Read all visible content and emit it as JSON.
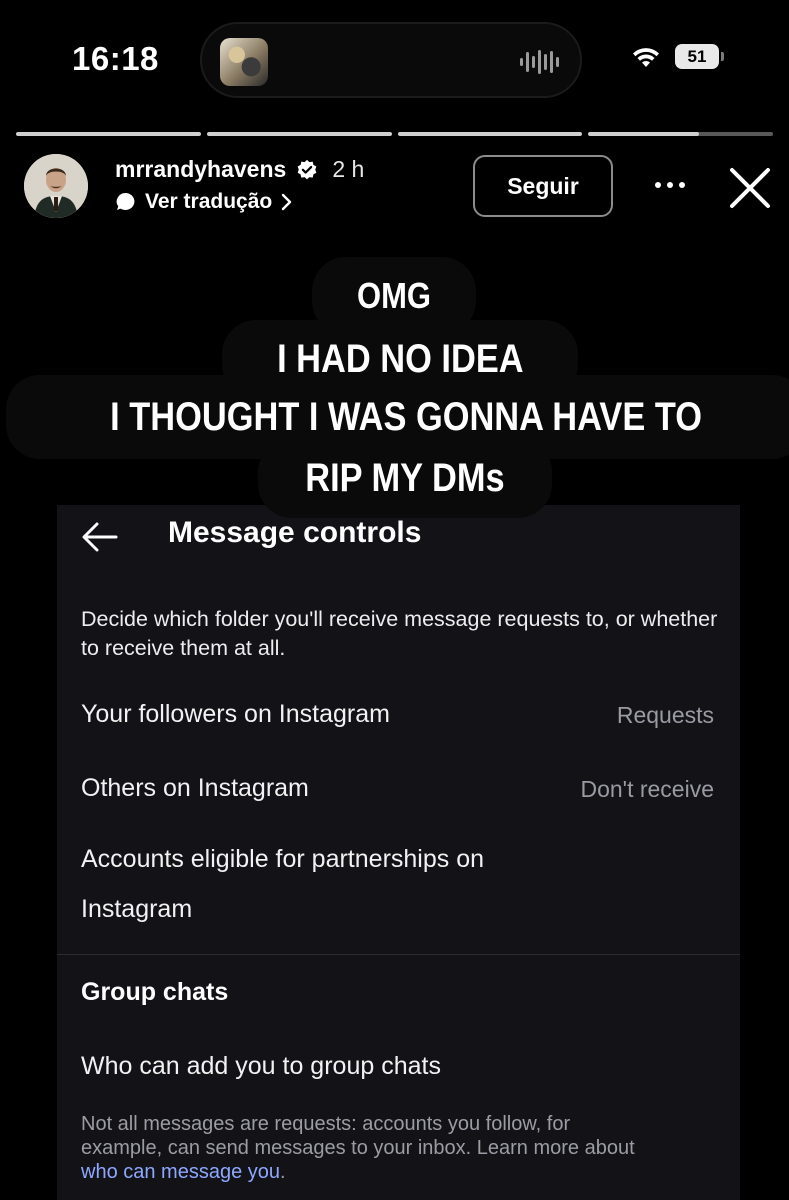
{
  "status_bar": {
    "time": "16:18",
    "battery": "51"
  },
  "story": {
    "username": "mrrandyhavens",
    "time_ago": "2 h",
    "translate_label": "Ver tradução",
    "follow_label": "Seguir",
    "progress_segments": [
      1,
      1,
      1,
      0.6
    ]
  },
  "captions": [
    "OMG",
    "I HAD NO IDEA",
    "I THOUGHT I WAS GONNA HAVE TO",
    "RIP MY DMs"
  ],
  "message_controls": {
    "title": "Message controls",
    "description": "Decide which folder you'll receive message requests to, or whether to receive them at all.",
    "rows": [
      {
        "label": "Your followers on Instagram",
        "value": "Requests"
      },
      {
        "label": "Others on Instagram",
        "value": "Don't receive"
      },
      {
        "label_line1": "Accounts eligible for partnerships on",
        "label_line2": "Instagram"
      }
    ],
    "section_title": "Group chats",
    "group_row": "Who can add you to group chats",
    "footnote_line1": "Not all messages are requests: accounts you follow, for",
    "footnote_line2": "example, can send messages to your inbox. Learn more about",
    "footnote_link": "who can message you",
    "footnote_end": "."
  },
  "colors": {
    "link": "#8ea8ff",
    "muted": "#9a9aa3",
    "panel": "#121217"
  }
}
